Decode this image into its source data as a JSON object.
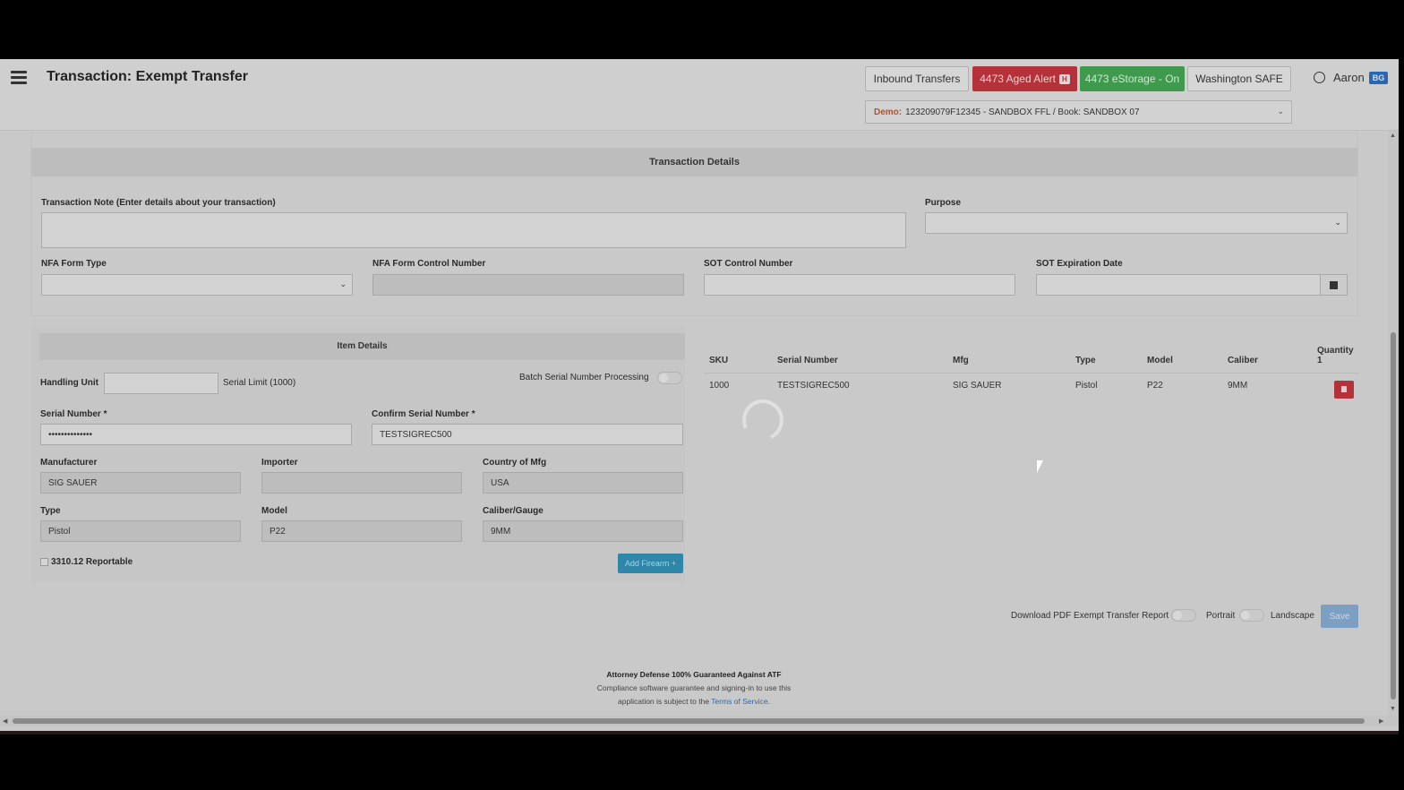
{
  "header": {
    "title": "Transaction: Exempt Transfer",
    "buttons": {
      "inbound": "Inbound Transfers",
      "aged_alert": "4473 Aged Alert",
      "aged_alert_badge": "H",
      "estorage": "4473 eStorage - On",
      "washington": "Washington SAFE"
    },
    "user": {
      "name": "Aaron",
      "badge": "BG"
    },
    "ffl_select": {
      "prefix": "Demo:",
      "value": "123209079F12345 - SANDBOX FFL / Book: SANDBOX 07"
    }
  },
  "transaction_details": {
    "heading": "Transaction Details",
    "note_label": "Transaction Note",
    "note_hint": "(Enter details about your transaction)",
    "purpose_label": "Purpose",
    "nfa_form_type_label": "NFA Form Type",
    "nfa_control_label": "NFA Form Control Number",
    "sot_control_label": "SOT Control Number",
    "sot_expiration_label": "SOT Expiration Date"
  },
  "item_details": {
    "heading": "Item Details",
    "handling_unit_label": "Handling Unit",
    "serial_limit": "Serial Limit (1000)",
    "batch_label": "Batch Serial Number Processing",
    "serial_label": "Serial Number *",
    "serial_value": "••••••••••••••",
    "confirm_serial_label": "Confirm Serial Number *",
    "confirm_serial_value": "TESTSIGREC500",
    "manufacturer_label": "Manufacturer",
    "manufacturer_value": "SIG SAUER",
    "importer_label": "Importer",
    "importer_value": "",
    "country_label": "Country of Mfg",
    "country_value": "USA",
    "type_label": "Type",
    "type_value": "Pistol",
    "model_label": "Model",
    "model_value": "P22",
    "caliber_label": "Caliber/Gauge",
    "caliber_value": "9MM",
    "reportable_label": "3310.12 Reportable",
    "add_button": "Add Firearm +"
  },
  "items_table": {
    "headers": [
      "SKU",
      "Serial Number",
      "Mfg",
      "Type",
      "Model",
      "Caliber"
    ],
    "quantity_label": "Quantity",
    "quantity_value": "1",
    "rows": [
      [
        "1000",
        "TESTSIGREC500",
        "SIG SAUER",
        "Pistol",
        "P22",
        "9MM"
      ]
    ]
  },
  "report": {
    "download_label": "Download PDF Exempt Transfer Report",
    "portrait": "Portrait",
    "landscape": "Landscape",
    "save": "Save"
  },
  "footer": {
    "line1": "Attorney Defense 100% Guaranteed Against ATF",
    "line2": "Compliance software guarantee and signing-in to use this",
    "line3": "application is subject to the",
    "link": "Terms of Service",
    "period": "."
  },
  "icons": [
    "hamburger-icon",
    "user-icon",
    "calendar-icon",
    "trash-icon",
    "chevron-down-icon",
    "loading-spinner-icon"
  ]
}
